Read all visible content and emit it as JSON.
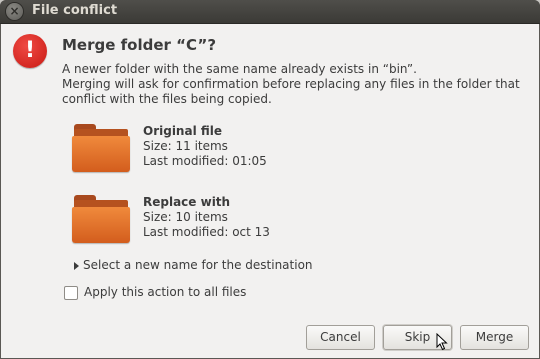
{
  "window": {
    "title": "File conflict",
    "close_glyph": "×"
  },
  "dialog": {
    "alert_glyph": "!",
    "heading": "Merge folder “C”?",
    "description_lines": [
      "A newer folder with the same name already exists in “bin”.",
      "Merging will ask for confirmation before replacing any files in the folder that",
      "conflict with the files being copied."
    ],
    "original": {
      "label": "Original file",
      "size": "Size: 11 items",
      "modified": "Last modified: 01:05"
    },
    "replacement": {
      "label": "Replace with",
      "size": "Size: 10 items",
      "modified": "Last modified: oct 13"
    },
    "expander_label": "Select a new name for the destination",
    "apply_all_label": "Apply this action to all files",
    "apply_all_checked": false,
    "buttons": {
      "cancel": "Cancel",
      "skip": "Skip",
      "merge": "Merge"
    }
  },
  "colors": {
    "titlebar": "#3b3a36",
    "folder": "#e0702a",
    "alert": "#e0332c"
  }
}
